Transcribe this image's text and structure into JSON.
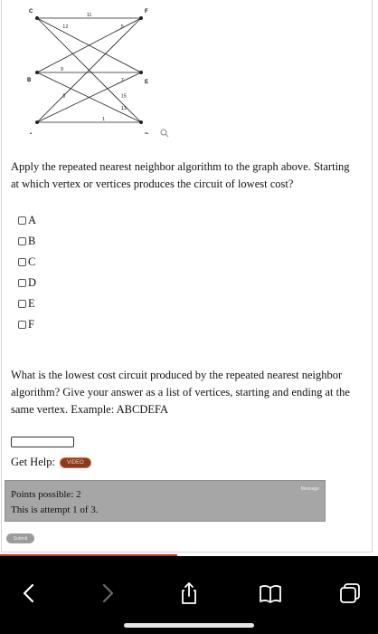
{
  "graph": {
    "vertices": [
      {
        "id": "A",
        "label": "A"
      },
      {
        "id": "B",
        "label": "B"
      },
      {
        "id": "C",
        "label": "C"
      },
      {
        "id": "D",
        "label": "D"
      },
      {
        "id": "E",
        "label": "E"
      },
      {
        "id": "F",
        "label": "F"
      }
    ],
    "edges": [
      {
        "from": "C",
        "to": "F",
        "weight": "11"
      },
      {
        "from": "C",
        "to": "E",
        "weight": "12"
      },
      {
        "from": "B",
        "to": "F",
        "weight": "5"
      },
      {
        "from": "C",
        "to": "D",
        "weight": "15"
      },
      {
        "from": "B",
        "to": "E",
        "weight": "9"
      },
      {
        "from": "A",
        "to": "E",
        "weight": "7"
      },
      {
        "from": "B",
        "to": "D",
        "weight": "13"
      },
      {
        "from": "A",
        "to": "F",
        "weight": "8"
      },
      {
        "from": "A",
        "to": "D",
        "weight": "1"
      }
    ]
  },
  "question1": {
    "text": "Apply the repeated nearest neighbor algorithm to the graph above. Starting at which vertex or vertices produces the circuit of lowest cost?",
    "options": [
      "A",
      "B",
      "C",
      "D",
      "E",
      "F"
    ]
  },
  "question2": {
    "text": "What is the lowest cost circuit produced by the repeated nearest neighbor algorithm? Give your answer as a list of vertices, starting and ending at the same vertex. Example: ABCDEFA",
    "answer_value": ""
  },
  "help": {
    "label": "Get Help:",
    "video_label": "VIDEO"
  },
  "points": {
    "possible": "Points possible: 2",
    "attempt": "This is attempt 1 of 3.",
    "more": "Message"
  },
  "submit_label": "Submit",
  "browser": {
    "icons": [
      "back-icon",
      "forward-icon",
      "share-icon",
      "bookmarks-icon",
      "tabs-icon"
    ]
  }
}
